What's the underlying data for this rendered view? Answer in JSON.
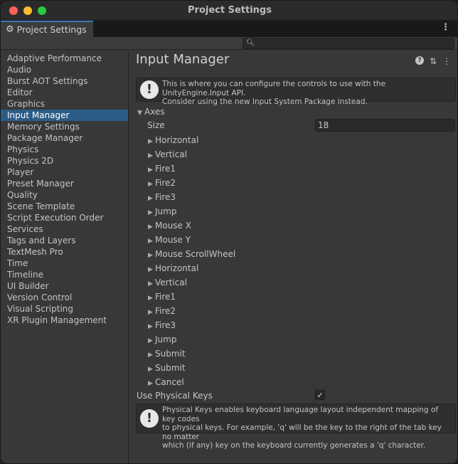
{
  "window": {
    "title": "Project Settings"
  },
  "tab": {
    "label": "Project Settings",
    "icon": "gear-icon"
  },
  "search": {
    "placeholder": ""
  },
  "sidebar": {
    "items": [
      "Adaptive Performance",
      "Audio",
      "Burst AOT Settings",
      "Editor",
      "Graphics",
      "Input Manager",
      "Memory Settings",
      "Package Manager",
      "Physics",
      "Physics 2D",
      "Player",
      "Preset Manager",
      "Quality",
      "Scene Template",
      "Script Execution Order",
      "Services",
      "Tags and Layers",
      "TextMesh Pro",
      "Time",
      "Timeline",
      "UI Builder",
      "Version Control",
      "Visual Scripting",
      "XR Plugin Management"
    ],
    "selected": "Input Manager"
  },
  "main": {
    "title": "Input Manager",
    "info_top_line1": "This is where you can configure the controls to use with the UnityEngine.Input API.",
    "info_top_line2": "Consider using the new Input System Package instead.",
    "axes_label": "Axes",
    "size_label": "Size",
    "size_value": "18",
    "axes": [
      "Horizontal",
      "Vertical",
      "Fire1",
      "Fire2",
      "Fire3",
      "Jump",
      "Mouse X",
      "Mouse Y",
      "Mouse ScrollWheel",
      "Horizontal",
      "Vertical",
      "Fire1",
      "Fire2",
      "Fire3",
      "Jump",
      "Submit",
      "Submit",
      "Cancel"
    ],
    "physical_keys_label": "Use Physical Keys",
    "physical_keys_checked": true,
    "info_bottom_line1": "Physical Keys enables keyboard language layout independent mapping of key codes",
    "info_bottom_line2": "to physical keys. For example, 'q' will be the key to the right of the tab key no matter",
    "info_bottom_line3": "which (if any) key on the keyboard currently generates a 'q' character."
  }
}
